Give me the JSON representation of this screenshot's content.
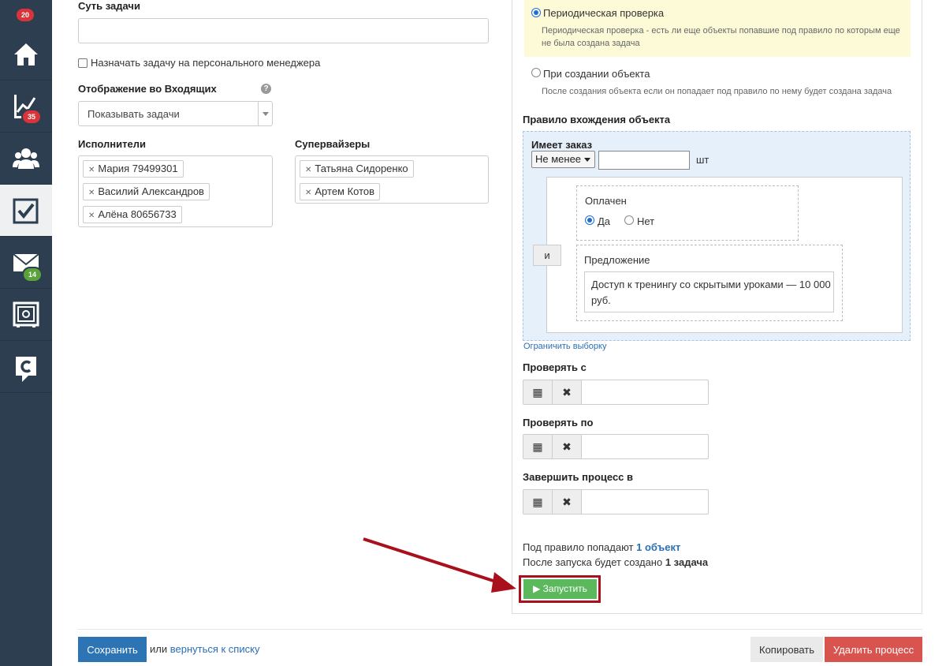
{
  "sidebar": {
    "badges": {
      "top": "20",
      "stats": "35",
      "mail": "14"
    },
    "items": [
      "home-icon",
      "chart-icon",
      "users-icon",
      "tasks-icon",
      "mail-icon",
      "safe-icon",
      "logo-icon"
    ]
  },
  "form": {
    "task_label": "Суть задачи",
    "task_value": "",
    "assign_manager_label": "Назначать задачу на персонального менеджера",
    "inbox_label": "Отображение во Входящих",
    "inbox_selected": "Показывать задачи",
    "executors_label": "Исполнители",
    "executors": [
      "Мария 79499301",
      "Василий Александров",
      "Алёна 80656733"
    ],
    "supervisors_label": "Супервайзеры",
    "supervisors": [
      "Татьяна Сидоренко",
      "Артем Котов"
    ]
  },
  "trigger": {
    "periodic_label": "Периодическая проверка",
    "periodic_desc_line1": "Периодическая проверка - есть ли еще объекты попавшие под правило по которым еще",
    "periodic_desc_line2": "не была создана задача",
    "on_create_label": "При создании объекта",
    "on_create_desc": "После создания объекта если он попадает под правило по нему будет создана задача",
    "selected": "periodic"
  },
  "rule": {
    "title": "Правило вхождения объекта",
    "has_order_label": "Имеет заказ",
    "compare_selected": "Не менее",
    "quantity_value": "",
    "unit": "шт",
    "and_label": "и",
    "paid_label": "Оплачен",
    "paid_yes": "Да",
    "paid_no": "Нет",
    "paid_selected": "yes",
    "offer_label": "Предложение",
    "offer_line1": "Доступ к тренингу со скрытыми уроками — 10 000",
    "offer_line2": "руб.",
    "limit_link": "Ограничить выборку"
  },
  "schedule": {
    "check_from_label": "Проверять с",
    "check_to_label": "Проверять по",
    "finish_label": "Завершить процесс в",
    "check_from_value": "",
    "check_to_value": "",
    "finish_value": ""
  },
  "summary": {
    "objects_prefix": "Под правило попадают",
    "objects_link": "1 объект",
    "tasks_prefix": "После запуска будет создано",
    "tasks_count": "1 задача"
  },
  "actions": {
    "run_label": "▶ Запустить",
    "save_label": "Сохранить",
    "or_text": "или",
    "back_link": "вернуться к списку",
    "copy_label": "Копировать",
    "delete_label": "Удалить процесс"
  },
  "colors": {
    "sidebar": "#2d3e50",
    "run": "#5cb85c",
    "highlight": "#a8101b",
    "primary": "#2d74b5",
    "danger": "#d9534f"
  }
}
